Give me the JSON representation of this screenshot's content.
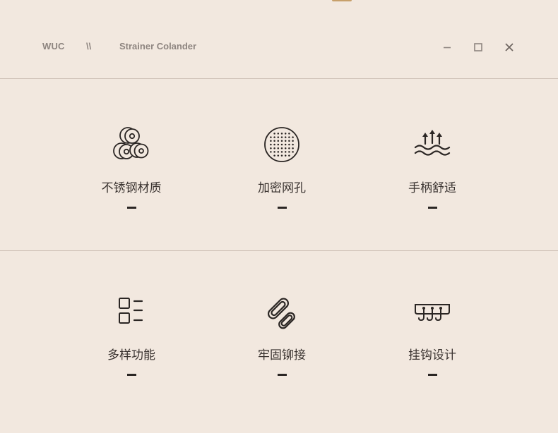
{
  "header": {
    "brand": "WUC",
    "separator": "\\\\",
    "product": "Strainer Colander"
  },
  "window_controls": [
    "minimize-icon",
    "maximize-icon",
    "close-icon"
  ],
  "features": [
    {
      "label": "不锈钢材质",
      "icon": "steel-rolls-icon"
    },
    {
      "label": "加密网孔",
      "icon": "mesh-holes-icon"
    },
    {
      "label": "手柄舒适",
      "icon": "comfort-wave-icon"
    },
    {
      "label": "多样功能",
      "icon": "multi-function-icon"
    },
    {
      "label": "牢固铆接",
      "icon": "chain-link-icon"
    },
    {
      "label": "挂钩设计",
      "icon": "hook-rack-icon"
    }
  ],
  "colors": {
    "background": "#f2e8df",
    "text": "#3a3330",
    "muted": "#8e8580",
    "accent": "#c7a06b"
  }
}
